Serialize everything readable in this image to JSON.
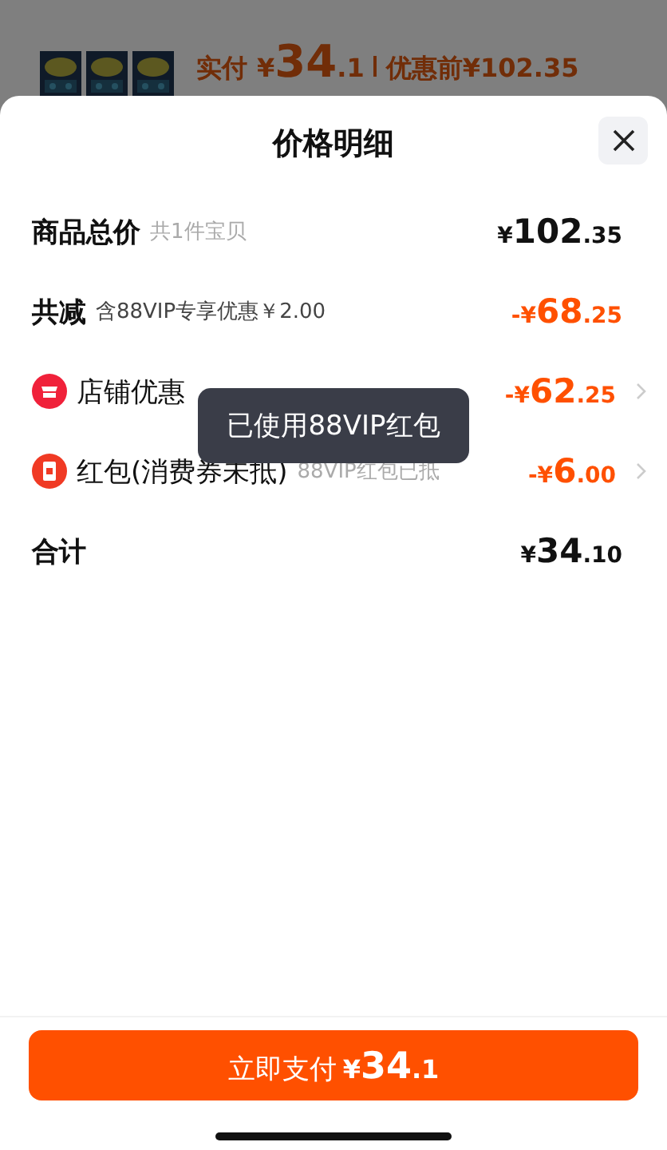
{
  "background_order": {
    "paid_label": "实付",
    "paid_amount": "¥34.1",
    "original_label": "优惠前",
    "original_amount": "¥102.35"
  },
  "sheet": {
    "title": "价格明细"
  },
  "rows": [
    {
      "kind": "plain",
      "label": "商品总价",
      "note": "共1件宝贝",
      "amount": "¥102.35",
      "discount": false,
      "chevron": false
    },
    {
      "kind": "plain",
      "label": "共减",
      "note": "含88VIP专享优惠￥2.00",
      "amount": "-¥68.25",
      "discount": true,
      "chevron": false
    },
    {
      "kind": "store",
      "label": "店铺优惠",
      "amount": "-¥62.25",
      "discount": true,
      "chevron": true
    },
    {
      "kind": "packet",
      "label": "红包(消费券未抵)",
      "note": "88VIP红包已抵",
      "amount": "-¥6.00",
      "discount": true,
      "chevron": true
    },
    {
      "kind": "plain",
      "label": "合计",
      "amount": "¥34.10",
      "discount": false,
      "chevron": false
    }
  ],
  "toast": "已使用88VIP红包",
  "pay_button": {
    "label": "立即支付",
    "amount": "¥34.1"
  }
}
